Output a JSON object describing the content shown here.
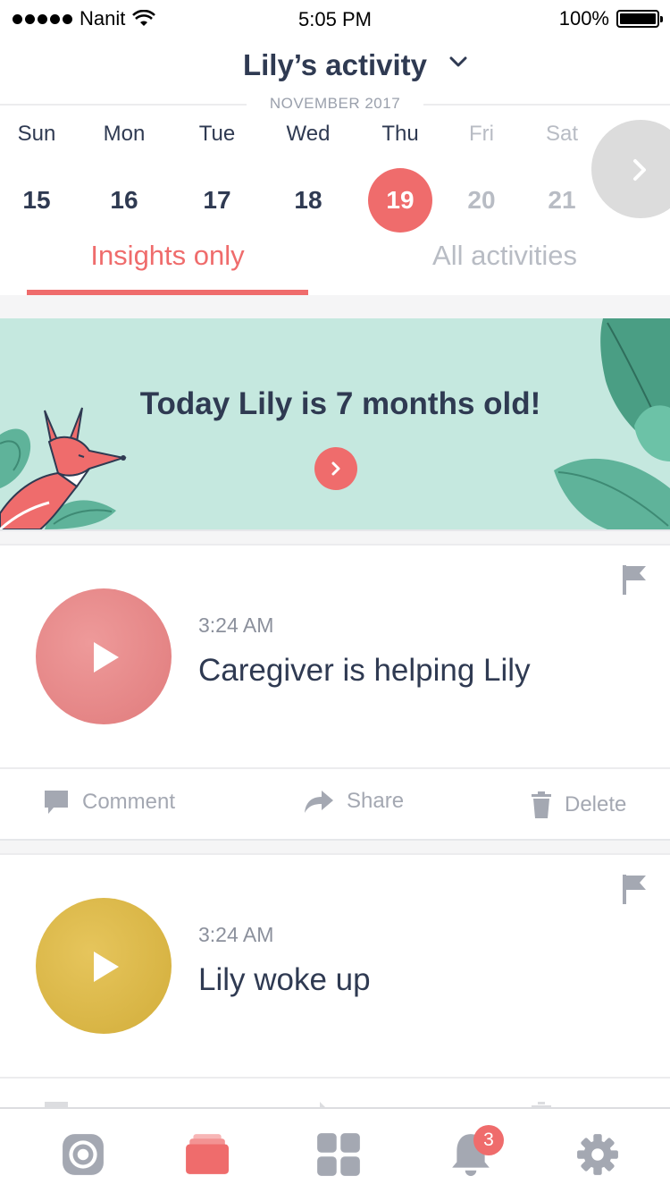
{
  "status_bar": {
    "carrier": "Nanit",
    "time": "5:05 PM",
    "battery": "100%"
  },
  "header": {
    "title": "Lily’s activity",
    "month": "NOVEMBER 2017",
    "days": [
      {
        "name": "Sun",
        "date": "15"
      },
      {
        "name": "Mon",
        "date": "16"
      },
      {
        "name": "Tue",
        "date": "17"
      },
      {
        "name": "Wed",
        "date": "18"
      },
      {
        "name": "Thu",
        "date": "19"
      },
      {
        "name": "Fri",
        "date": "20"
      },
      {
        "name": "Sat",
        "date": "21"
      }
    ],
    "selected_day": "19"
  },
  "tabs": {
    "insights": "Insights only",
    "all": "All activities"
  },
  "banner": {
    "text": "Today Lily is 7 months old!"
  },
  "cards": [
    {
      "time": "3:24 AM",
      "caption": "Caregiver is helping Lily",
      "color": "#e57f80"
    },
    {
      "time": "3:24 AM",
      "caption": "Lily woke up",
      "color": "#d9b440"
    }
  ],
  "actions": {
    "comment": "Comment",
    "share": "Share",
    "delete": "Delete"
  },
  "tabbar": {
    "notifications_count": "3"
  },
  "colors": {
    "accent": "#ef6c6c",
    "text": "#2f3a52",
    "muted": "#b8bcc4",
    "banner_bg": "#c5e8df"
  }
}
